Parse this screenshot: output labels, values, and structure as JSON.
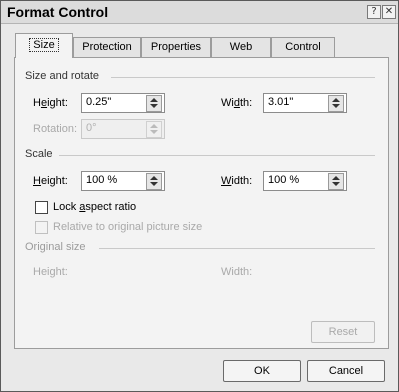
{
  "window": {
    "title": "Format Control",
    "help_glyph": "?",
    "close_glyph": "✕"
  },
  "tabs": [
    {
      "label": "Size",
      "active": true
    },
    {
      "label": "Protection",
      "active": false
    },
    {
      "label": "Properties",
      "active": false
    },
    {
      "label": "Web",
      "active": false
    },
    {
      "label": "Control",
      "active": false
    }
  ],
  "size_and_rotate": {
    "section_label": "Size and rotate",
    "height_label": "Height:",
    "height_value": "0.25\"",
    "width_label": "Width:",
    "width_value": "3.01\"",
    "rotation_label": "Rotation:",
    "rotation_value": "0°"
  },
  "scale": {
    "section_label": "Scale",
    "height_label": "Height:",
    "height_value": "100 %",
    "width_label": "Width:",
    "width_value": "100 %",
    "lock_aspect_label": "Lock aspect ratio",
    "lock_aspect_checked": false,
    "relative_label": "Relative to original picture size",
    "relative_checked": false
  },
  "original_size": {
    "section_label": "Original size",
    "height_label": "Height:",
    "width_label": "Width:"
  },
  "buttons": {
    "reset": "Reset",
    "ok": "OK",
    "cancel": "Cancel"
  }
}
